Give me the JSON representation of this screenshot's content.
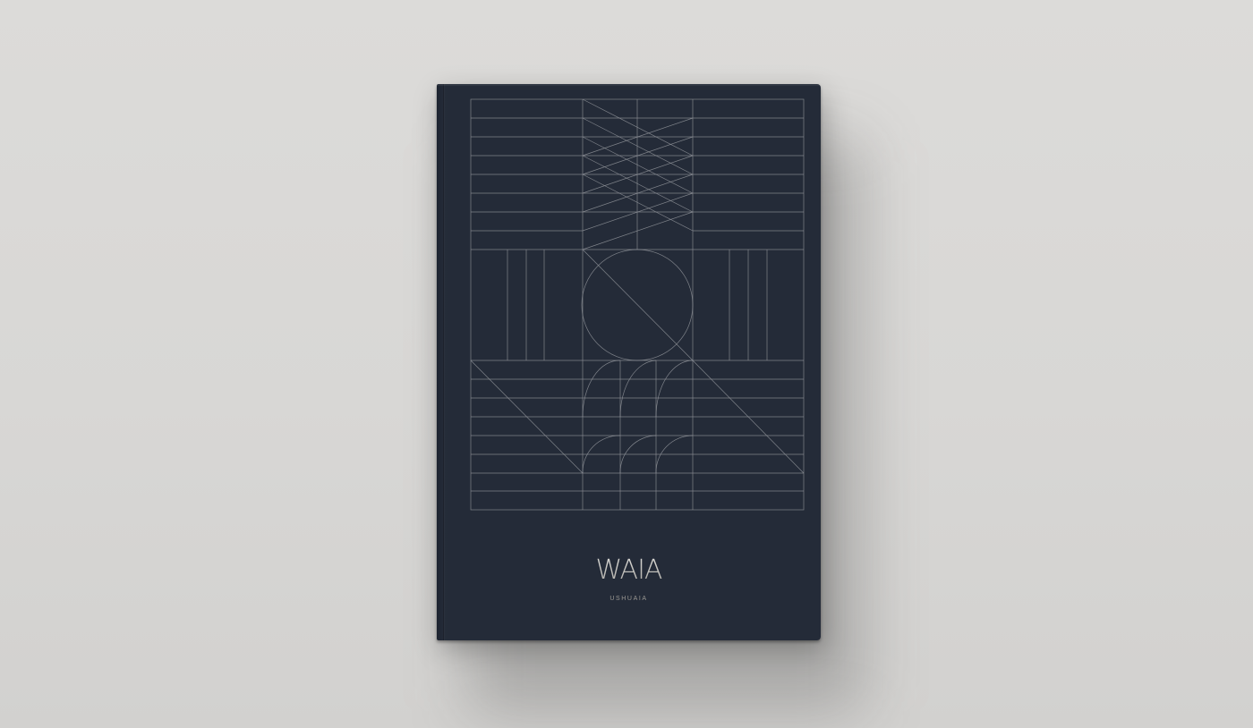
{
  "scene": {
    "background_color": "#dad9d7",
    "book_color": "#242b38",
    "line_color": "#8f9399"
  },
  "cover": {
    "title": "WAIA",
    "subtitle": "USHUAIA"
  }
}
